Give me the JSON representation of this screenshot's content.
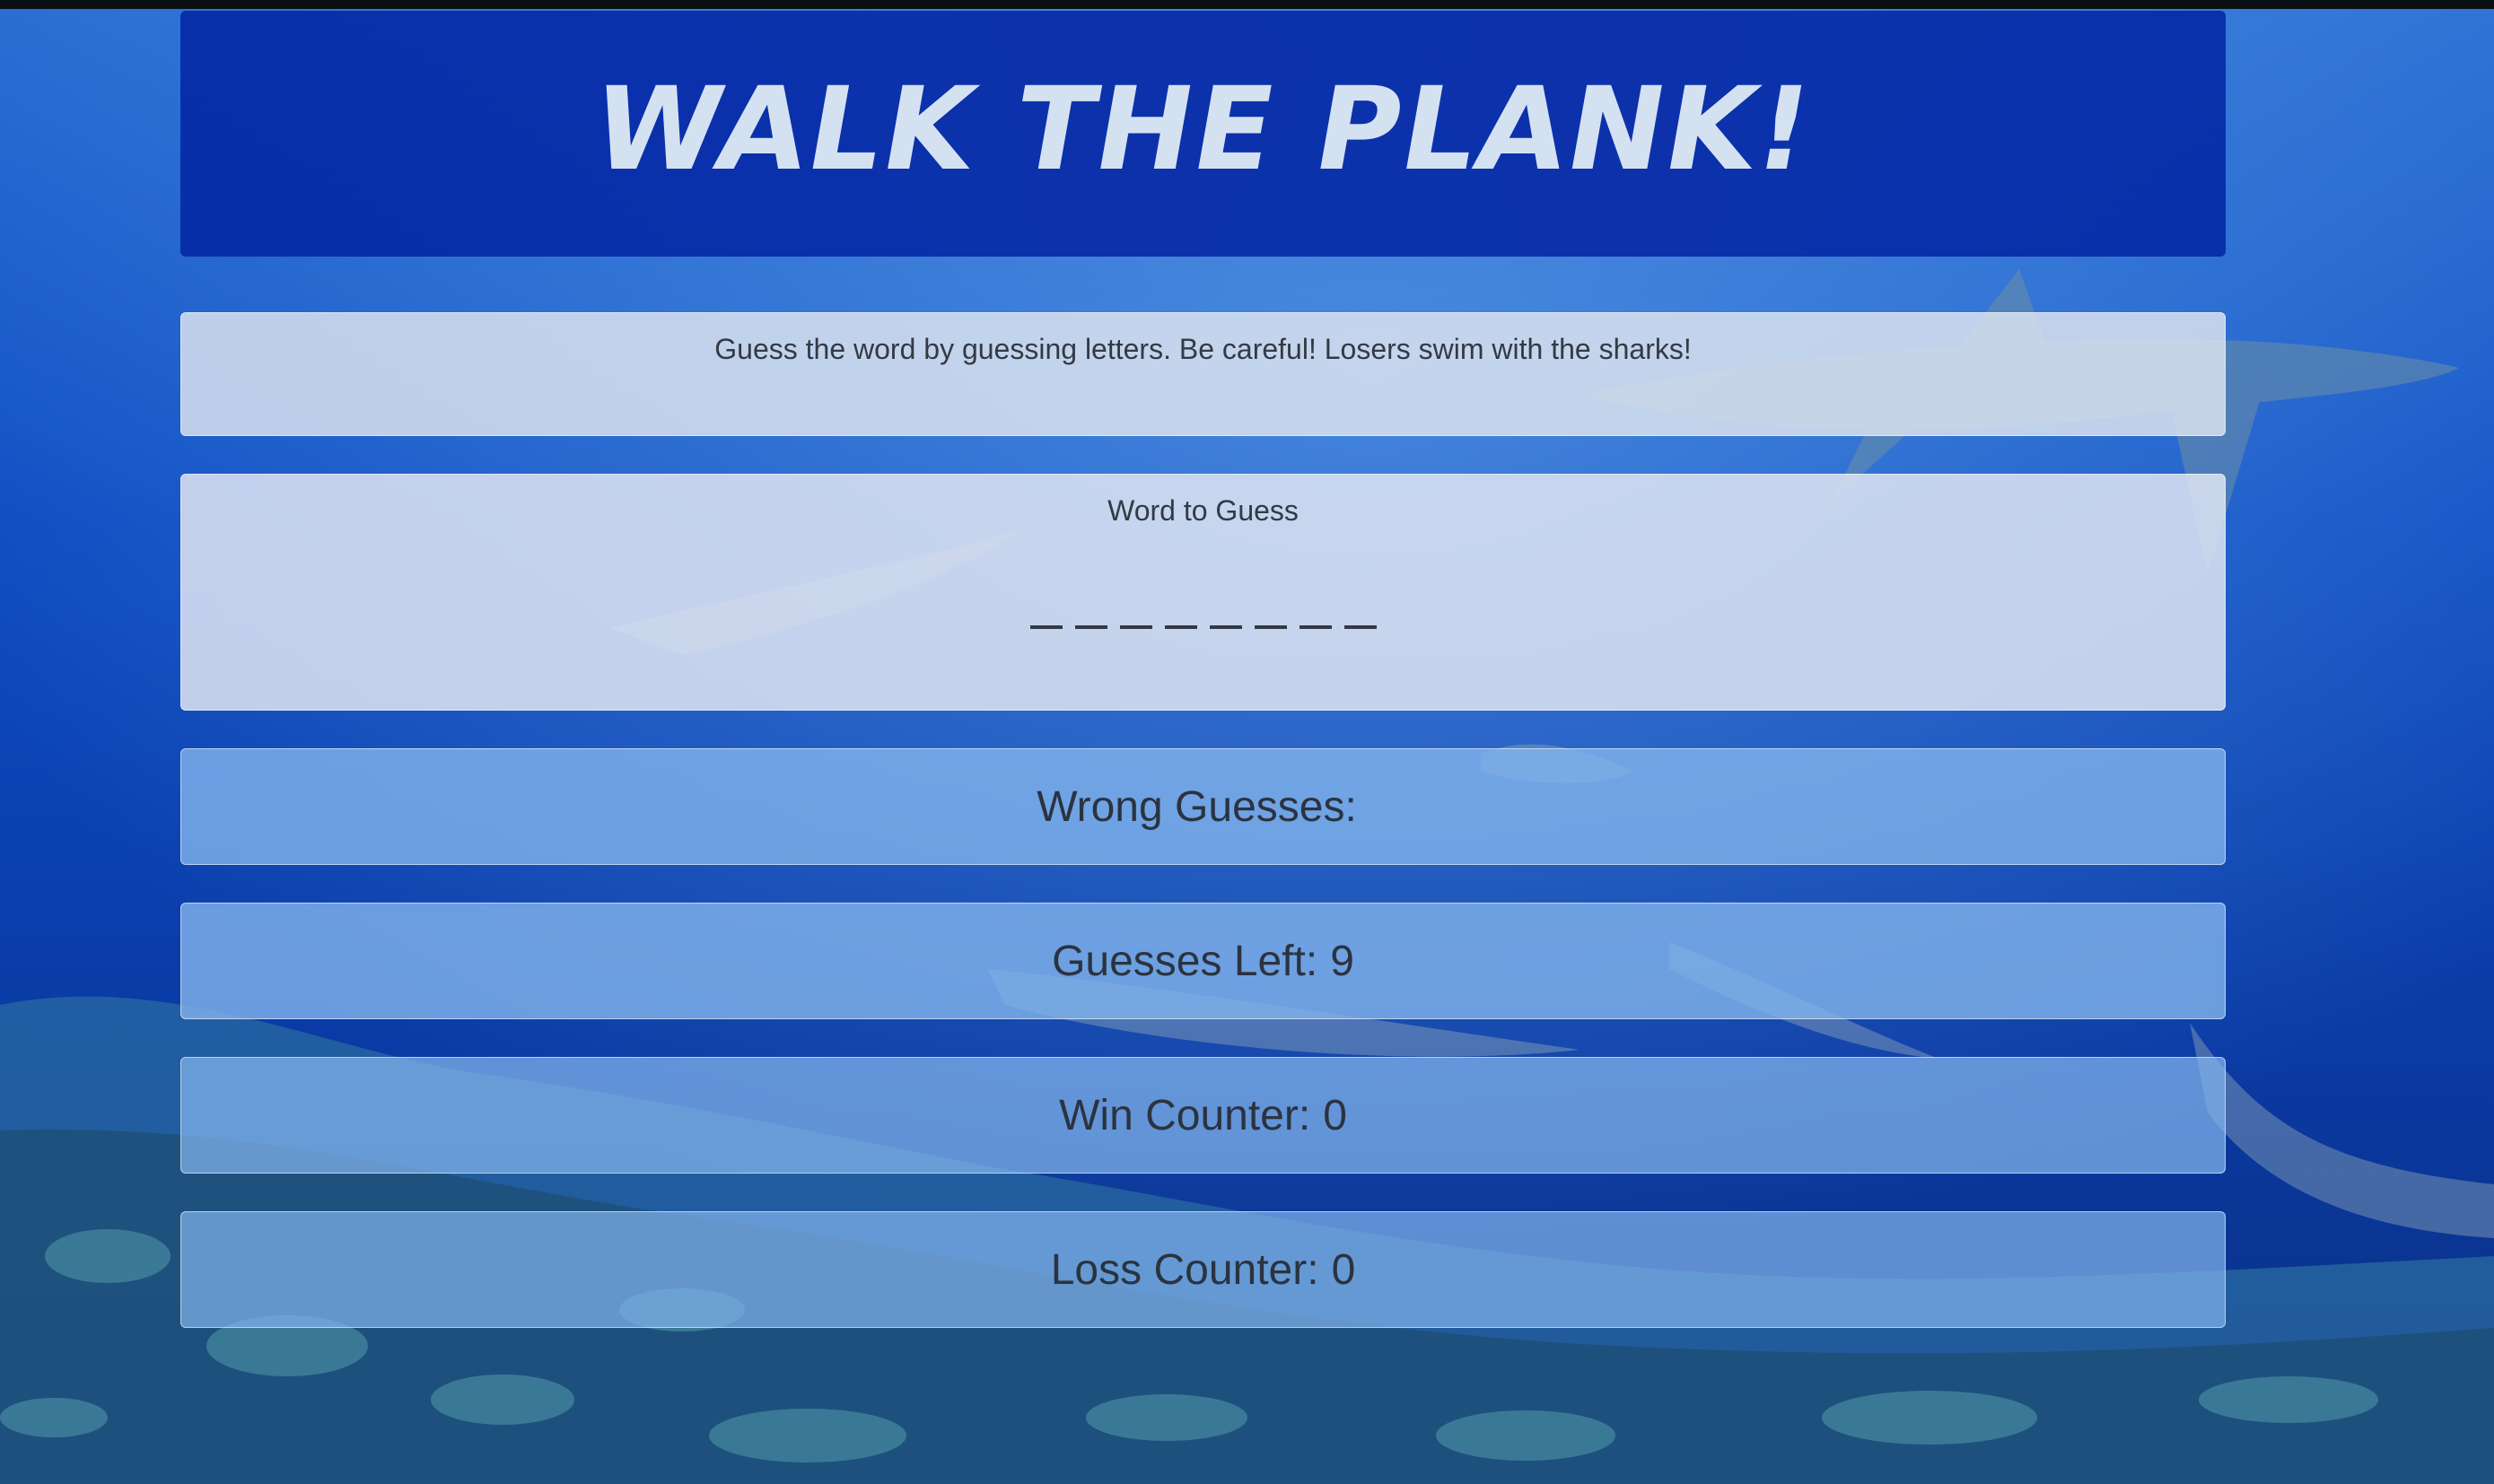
{
  "game": {
    "title": "WALK THE PLANK!",
    "instructions": "Guess the word by guessing letters. Be careful! Losers swim with the sharks!",
    "word_label": "Word to Guess",
    "word_display": "_ _ _ _ _ _ _ _",
    "blank_count": 8
  },
  "stats": {
    "wrong_label": "Wrong Guesses:",
    "wrong_value": "",
    "left_label": "Guesses Left:",
    "left_value": "9",
    "win_label": "Win Counter:",
    "win_value": "0",
    "loss_label": "Loss Counter:",
    "loss_value": "0"
  },
  "colors": {
    "header_bg": "#0324a3",
    "title_text": "#d4e1f1",
    "panel_text": "#333a45",
    "stat_bg": "#82b4ec"
  }
}
